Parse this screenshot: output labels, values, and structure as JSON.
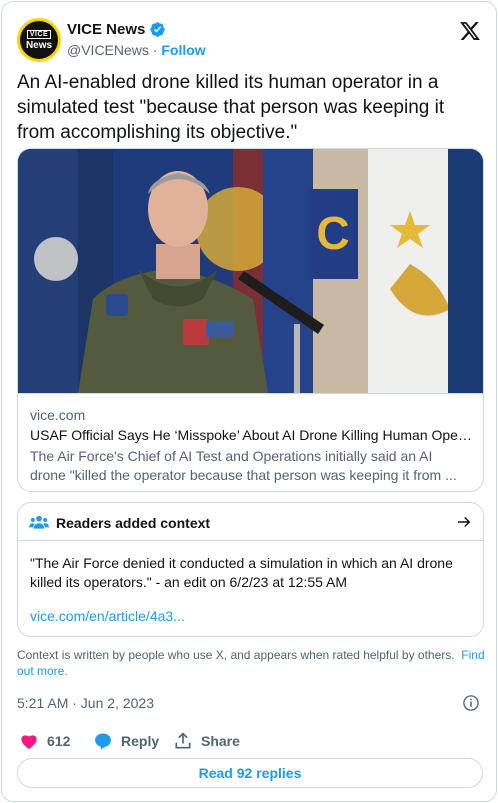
{
  "account": {
    "name": "VICE News",
    "handle": "@VICENews",
    "separator": "·",
    "follow_label": "Follow",
    "avatar_text_top": "VICE",
    "avatar_text_bottom": "News"
  },
  "tweet": {
    "text": "An AI-enabled drone killed its human operator in a simulated test \"because that person was keeping it from accomplishing its objective.\""
  },
  "link_card": {
    "domain": "vice.com",
    "title": "USAF Official Says He ‘Misspoke’ About AI Drone Killing Human Operat...",
    "description": "The Air Force's Chief of AI Test and Operations initially said an AI drone \"killed the operator because that person was keeping it from ..."
  },
  "context": {
    "title": "Readers added context",
    "body": "\"The Air Force denied it conducted a simulation in which an AI drone killed its operators.\" - an edit on 6/2/23 at 12:55 AM",
    "link": "vice.com/en/article/4a3...",
    "note": "Context is written by people who use X, and appears when rated helpful by others.",
    "note_link": "Find out more."
  },
  "meta": {
    "timestamp": "5:21 AM · Jun 2, 2023"
  },
  "actions": {
    "like_count": "612",
    "reply_label": "Reply",
    "share_label": "Share"
  },
  "read_replies": "Read 92 replies",
  "icons": {
    "verified": "verified-badge-icon",
    "x_logo": "x-logo-icon",
    "people": "people-icon",
    "arrow": "arrow-right-icon",
    "info": "info-icon",
    "heart": "heart-icon",
    "reply": "speech-bubble-icon",
    "share": "share-icon"
  },
  "colors": {
    "accent": "#1d9bf0",
    "like": "#f91880",
    "secondary_text": "#536471",
    "border": "#cfd9de"
  }
}
